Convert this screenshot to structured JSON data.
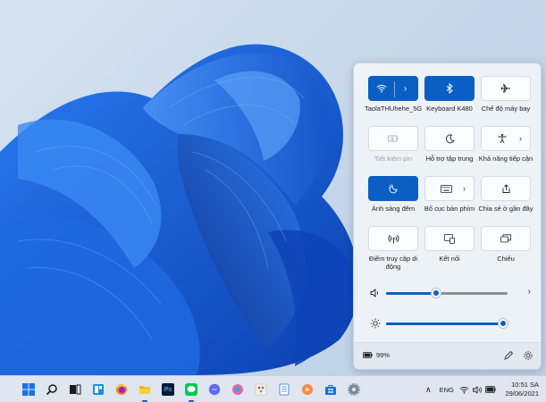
{
  "quick_settings": {
    "tiles": [
      {
        "id": "wifi",
        "label": "TaolaTHUhehe_5G",
        "on": true,
        "split": true,
        "icon": "wifi-icon"
      },
      {
        "id": "bluetooth",
        "label": "Keyboard K480",
        "on": true,
        "split": false,
        "icon": "bluetooth-icon"
      },
      {
        "id": "airplane",
        "label": "Chế độ máy bay",
        "on": false,
        "split": false,
        "icon": "airplane-icon"
      },
      {
        "id": "battery-saver",
        "label": "Tiết kiệm pin",
        "on": false,
        "disabled": true,
        "icon": "battery-saver-icon"
      },
      {
        "id": "focus-assist",
        "label": "Hỗ trợ tập trung",
        "on": false,
        "icon": "moon-icon"
      },
      {
        "id": "accessibility",
        "label": "Khả năng tiếp cận",
        "on": false,
        "chevron": true,
        "icon": "accessibility-icon"
      },
      {
        "id": "night-light",
        "label": "Ánh sáng đêm",
        "on": true,
        "icon": "night-light-icon"
      },
      {
        "id": "keyboard-layout",
        "label": "Bố cục bàn phím",
        "on": false,
        "chevron": true,
        "icon": "keyboard-icon"
      },
      {
        "id": "nearby-share",
        "label": "Chia sẻ ở gần đây",
        "on": false,
        "icon": "share-icon"
      },
      {
        "id": "mobile-hotspot",
        "label": "Điểm truy cập di động",
        "on": false,
        "icon": "hotspot-icon"
      },
      {
        "id": "connect",
        "label": "Kết nối",
        "on": false,
        "icon": "cast-icon"
      },
      {
        "id": "project",
        "label": "Chiếu",
        "on": false,
        "icon": "project-icon"
      }
    ],
    "volume_level": 0.41,
    "brightness_level": 1.0,
    "battery_percent": "99%"
  },
  "taskbar": {
    "apps": [
      "start-icon",
      "search-icon",
      "task-view-icon",
      "widgets-icon",
      "firefox-icon",
      "file-explorer-icon",
      "photoshop-icon",
      "line-icon",
      "messenger-icon",
      "edge-icon",
      "paint-icon",
      "notepad-icon",
      "media-player-icon",
      "store-icon",
      "settings-icon"
    ],
    "photoshop_label": "Ps",
    "language": "ENG",
    "time": "10:51 SA",
    "date": "29/06/2021"
  },
  "colors": {
    "accent": "#0a5fc4",
    "panel": "#eef3f9",
    "taskbar": "#dfe6ef"
  }
}
